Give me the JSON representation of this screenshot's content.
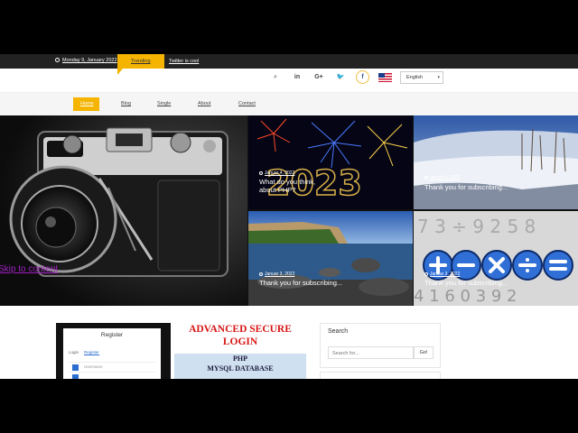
{
  "topbar": {
    "date": "Monday 9, January 2022",
    "trending_label": "Trending",
    "ticker_text": "Twitter is cool",
    "colors": {
      "bar": "#222222",
      "accent": "#f5b400"
    }
  },
  "social_icons": [
    "search-icon",
    "linkedin-icon",
    "google-plus-icon",
    "twitter-icon",
    "facebook-icon"
  ],
  "social_glyphs": {
    "search": "⌕",
    "linkedin": "in",
    "google": "G+",
    "twitter": "🐦",
    "facebook": "f"
  },
  "language": {
    "selected": "English",
    "flag": "us-flag-icon"
  },
  "nav": {
    "home": "Home",
    "blog": "Blog",
    "single": "Single",
    "about": "About",
    "contact": "Contact"
  },
  "hero": {
    "skip_link": "Skip to content",
    "tiles": [
      {
        "date": "Januar 4, 2022",
        "title": "What do you think, about PHP?"
      },
      {
        "date": "Januar 3, 2022",
        "title": "Thank you for subscribing..."
      },
      {
        "date": "Januar 3, 2022",
        "title": "Thank you for subscribing..."
      },
      {
        "date": "Januar 3, 2022",
        "title": "Thank you for subscribing..."
      }
    ]
  },
  "register_card": {
    "title": "Register",
    "tab_login": "Login",
    "tab_register": "Register",
    "username_placeholder": "Username"
  },
  "ad_banner": {
    "line1": "ADVANCED SECURE",
    "line2": "LOGIN",
    "line3": "PHP",
    "line4": "MYSQL DATABASE"
  },
  "search_widget": {
    "title": "Search",
    "placeholder": "Search for...",
    "button": "Go!"
  }
}
